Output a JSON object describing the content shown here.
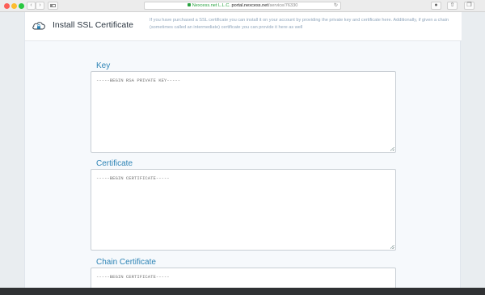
{
  "browser": {
    "url_org": "Nexcess.net L.L.C.",
    "url_host": "portal.nexcess.net",
    "url_path": "/service/76330"
  },
  "header": {
    "title": "Install SSL Certificate",
    "description": "If you have purchased a SSL certificate you can install it on your account by providing the private key and certificate here. Additionally, if given a chain (sometimes called an intermediate) certificate you can provide it here as well"
  },
  "fields": {
    "key": {
      "label": "Key",
      "placeholder": "-----BEGIN RSA PRIVATE KEY-----"
    },
    "certificate": {
      "label": "Certificate",
      "placeholder": "-----BEGIN CERTIFICATE-----"
    },
    "chain": {
      "label": "Chain Certificate",
      "placeholder": "-----BEGIN CERTIFICATE-----"
    }
  },
  "colors": {
    "accent": "#2c83b5",
    "description_text": "#8fa5bb"
  },
  "icons": {
    "header": "cloud-lock-icon"
  }
}
